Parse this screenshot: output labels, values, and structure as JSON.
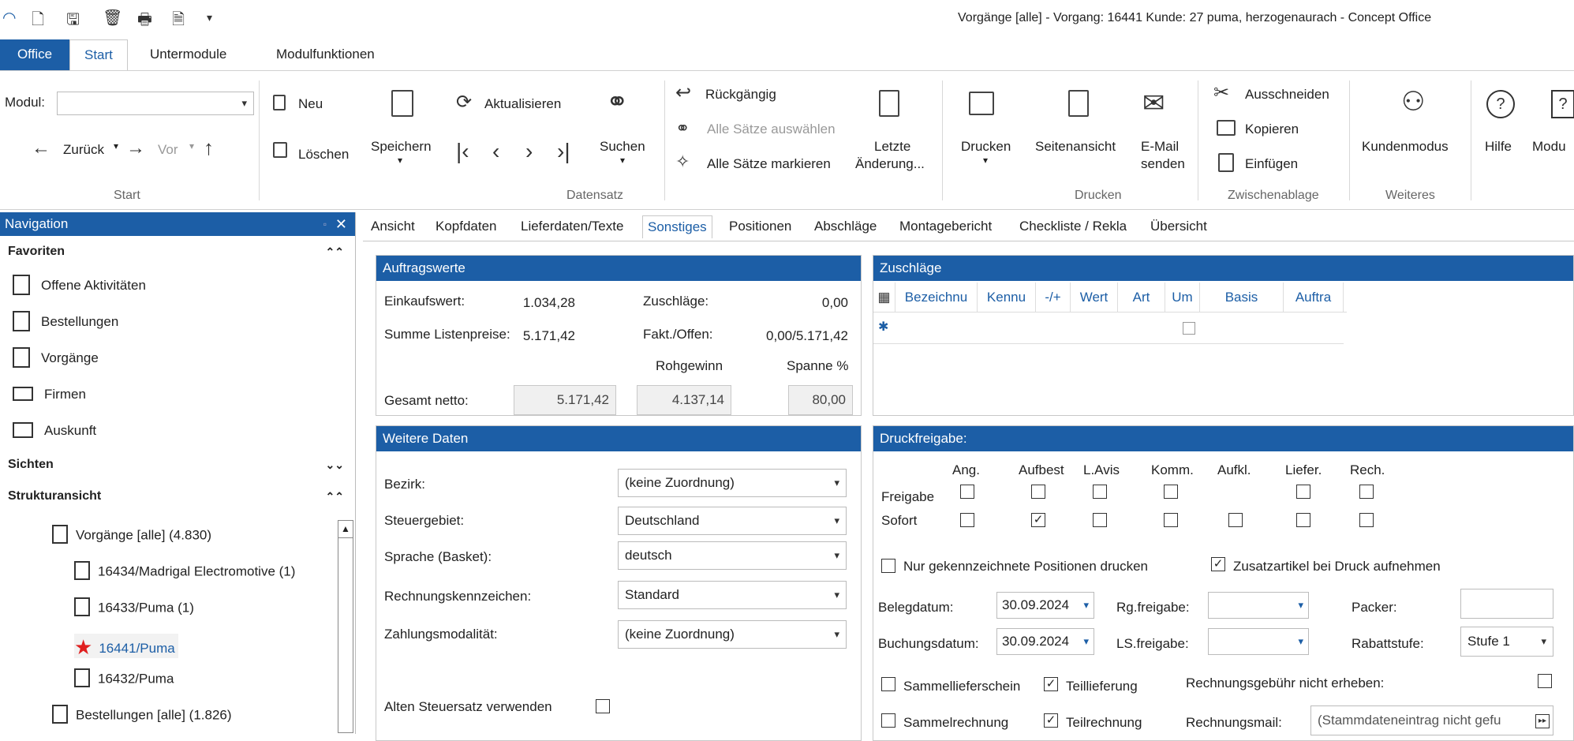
{
  "window": {
    "title": "Vorgänge [alle] - Vorgang: 16441 Kunde: 27 puma, herzogenaurach - Concept Office"
  },
  "ribbon_tabs": [
    "Office",
    "Start",
    "Untermodule",
    "Modulfunktionen"
  ],
  "ribbon": {
    "modul_label": "Modul:",
    "zurueck": "Zurück",
    "vor": "Vor",
    "neu": "Neu",
    "loeschen": "Löschen",
    "speichern": "Speichern",
    "aktualisieren": "Aktualisieren",
    "suchen": "Suchen",
    "rueckgaengig": "Rückgängig",
    "alle_saetze_auswaehlen": "Alle Sätze auswählen",
    "alle_saetze_markieren": "Alle Sätze markieren",
    "letzte_aenderung": "Letzte Änderung...",
    "letzte_l1": "Letzte",
    "letzte_l2": "Änderung...",
    "drucken": "Drucken",
    "seitenansicht": "Seitenansicht",
    "email_l1": "E-Mail",
    "email_l2": "senden",
    "ausschneiden": "Ausschneiden",
    "kopieren": "Kopieren",
    "einfuegen": "Einfügen",
    "kundenmodus": "Kundenmodus",
    "hilfe": "Hilfe",
    "modul_trunc": "Modu",
    "groups": {
      "start": "Start",
      "datensatz": "Datensatz",
      "drucken": "Drucken",
      "zwischenablage": "Zwischenablage",
      "weiteres": "Weiteres"
    }
  },
  "nav": {
    "title": "Navigation",
    "favoriten": "Favoriten",
    "items": [
      "Offene Aktivitäten",
      "Bestellungen",
      "Vorgänge",
      "Firmen",
      "Auskunft"
    ],
    "sichten": "Sichten",
    "strukturansicht": "Strukturansicht",
    "tree": [
      "Vorgänge [alle] (4.830)",
      "16434/Madrigal Electromotive (1)",
      "16433/Puma (1)",
      "16441/Puma",
      "16432/Puma",
      "Bestellungen [alle] (1.826)"
    ]
  },
  "content_tabs": [
    "Ansicht",
    "Kopfdaten",
    "Lieferdaten/Texte",
    "Sonstiges",
    "Positionen",
    "Abschläge",
    "Montagebericht",
    "Checkliste / Rekla",
    "Übersicht"
  ],
  "auftragswerte": {
    "title": "Auftragswerte",
    "einkaufswert_label": "Einkaufswert:",
    "einkaufswert": "1.034,28",
    "zuschlaege_label": "Zuschläge:",
    "zuschlaege": "0,00",
    "summe_label": "Summe Listenpreise:",
    "summe": "5.171,42",
    "fakt_label": "Fakt./Offen:",
    "fakt": "0,00/5.171,42",
    "rohgewinn_label": "Rohgewinn",
    "spanne_label": "Spanne %",
    "gesamt_label": "Gesamt netto:",
    "gesamt": "5.171,42",
    "rohgewinn": "4.137,14",
    "spanne": "80,00"
  },
  "zuschlaege": {
    "title": "Zuschläge",
    "columns": [
      "Bezeichnu",
      "Kennu",
      "-/+",
      "Wert",
      "Art",
      "Um",
      "Basis",
      "Auftra"
    ],
    "new_row": "✱"
  },
  "weitere": {
    "title": "Weitere Daten",
    "fields": [
      {
        "label": "Bezirk:",
        "value": "(keine Zuordnung)"
      },
      {
        "label": "Steuergebiet:",
        "value": "Deutschland"
      },
      {
        "label": "Sprache (Basket):",
        "value": "deutsch"
      },
      {
        "label": "Rechnungskennzeichen:",
        "value": "Standard"
      },
      {
        "label": "Zahlungsmodalität:",
        "value": "(keine Zuordnung)"
      }
    ],
    "alten": "Alten Steuersatz verwenden"
  },
  "druck": {
    "title": "Druckfreigabe:",
    "cols": [
      "Ang.",
      "Aufbest",
      "L.Avis",
      "Komm.",
      "Aufkl.",
      "Liefer.",
      "Rech."
    ],
    "freigabe": "Freigabe",
    "sofort": "Sofort",
    "nur_gekennzeichnete": "Nur gekennzeichnete Positionen drucken",
    "zusatzartikel": "Zusatzartikel bei Druck aufnehmen",
    "belegdatum_label": "Belegdatum:",
    "belegdatum": "30.09.2024",
    "rg_label": "Rg.freigabe:",
    "packer_label": "Packer:",
    "buchungsdatum_label": "Buchungsdatum:",
    "buchungsdatum": "30.09.2024",
    "ls_label": "LS.freigabe:",
    "rabatt_label": "Rabattstufe:",
    "rabatt": "Stufe 1",
    "sammellieferschein": "Sammellieferschein",
    "teillieferung": "Teillieferung",
    "rechnungsgebuehr": "Rechnungsgebühr nicht erheben:",
    "sammelrechnung": "Sammelrechnung",
    "teilrechnung": "Teilrechnung",
    "rechnungsmail_label": "Rechnungsmail:",
    "rechnungsmail": "(Stammdateneintrag nicht gefu"
  },
  "colors": {
    "accent": "#1c5ea6",
    "favorite_star": "#e02020"
  }
}
